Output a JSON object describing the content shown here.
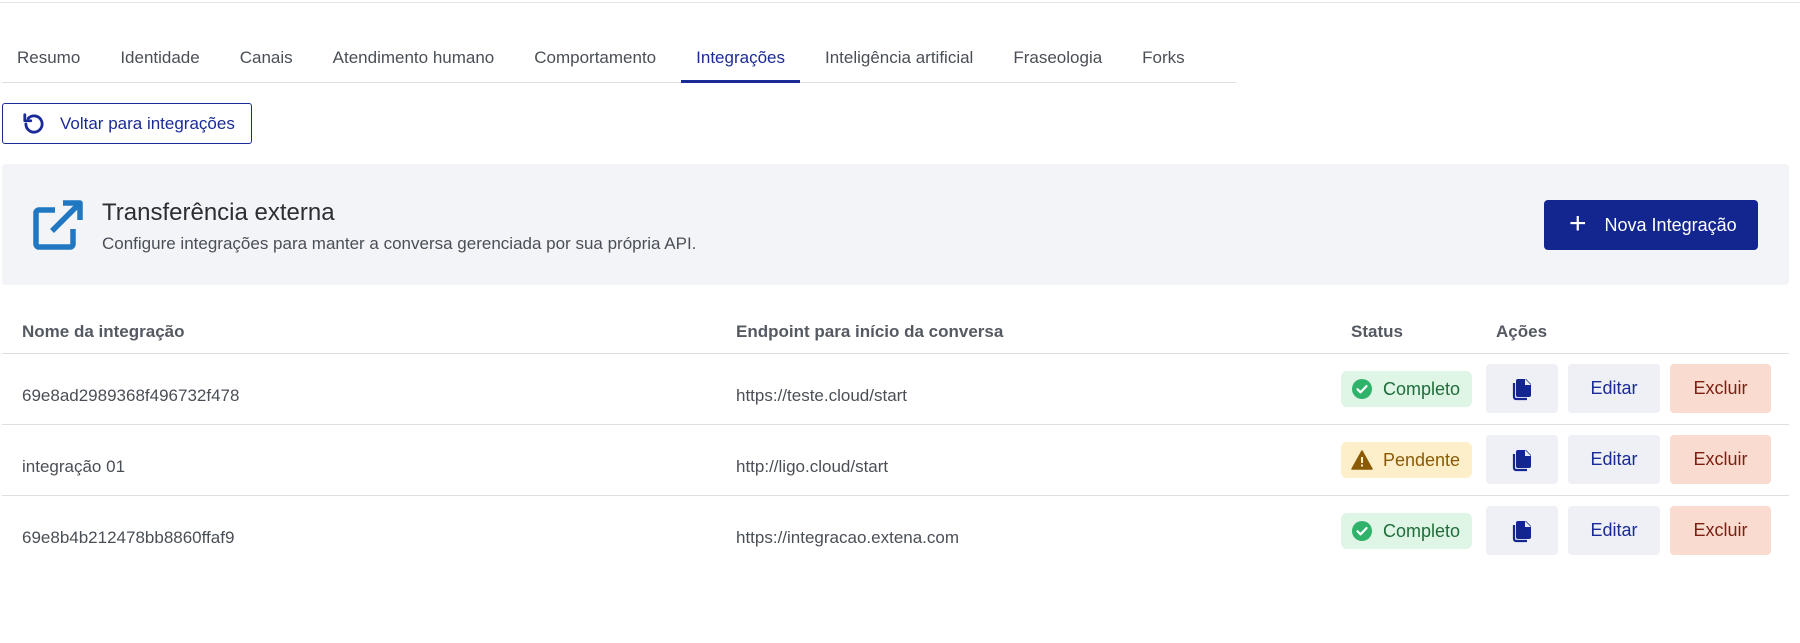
{
  "tabs": [
    {
      "label": "Resumo",
      "active": false
    },
    {
      "label": "Identidade",
      "active": false
    },
    {
      "label": "Canais",
      "active": false
    },
    {
      "label": "Atendimento humano",
      "active": false
    },
    {
      "label": "Comportamento",
      "active": false
    },
    {
      "label": "Integrações",
      "active": true
    },
    {
      "label": "Inteligência artificial",
      "active": false
    },
    {
      "label": "Fraseologia",
      "active": false
    },
    {
      "label": "Forks",
      "active": false
    }
  ],
  "back_button": {
    "label": "Voltar para integrações",
    "icon": "undo-icon"
  },
  "banner": {
    "icon": "external-link-icon",
    "title": "Transferência externa",
    "subtitle": "Configure integrações para manter a conversa gerenciada por sua própria API.",
    "new_button_label": "Nova Integração",
    "new_button_icon": "plus-icon"
  },
  "table": {
    "headers": {
      "name": "Nome da integração",
      "endpoint": "Endpoint para início da conversa",
      "status": "Status",
      "actions": "Ações"
    },
    "rows": [
      {
        "name": "69e8ad2989368f496732f478",
        "endpoint": "https://teste.cloud/start",
        "status": "Completo",
        "status_kind": "complete",
        "edit": "Editar",
        "delete": "Excluir"
      },
      {
        "name": "integração 01",
        "endpoint": "http://ligo.cloud/start",
        "status": "Pendente",
        "status_kind": "pending",
        "edit": "Editar",
        "delete": "Excluir"
      },
      {
        "name": "69e8b4b212478bb8860ffaf9",
        "endpoint": "https://integracao.extena.com",
        "status": "Completo",
        "status_kind": "complete",
        "edit": "Editar",
        "delete": "Excluir"
      }
    ]
  },
  "colors": {
    "primary": "#13268f",
    "complete_bg": "#dff5e6",
    "complete_icon": "#2fb36a",
    "pending_bg": "#fcefc9",
    "pending_icon": "#8a5a05",
    "delete_bg": "#f9dccf"
  }
}
